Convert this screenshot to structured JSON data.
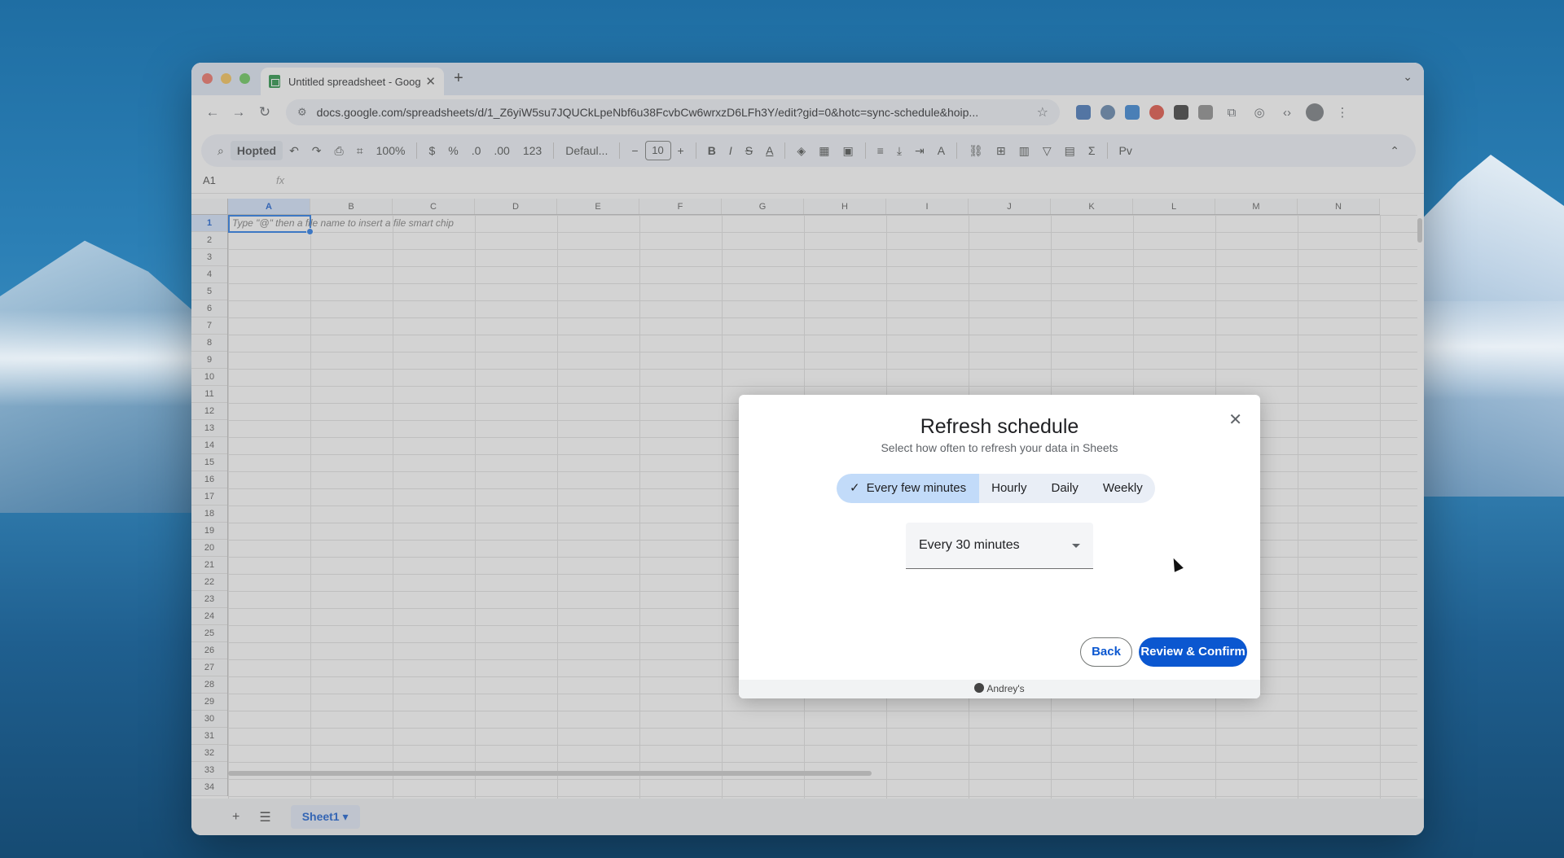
{
  "browser": {
    "tab_title": "Untitled spreadsheet - Googl",
    "url": "docs.google.com/spreadsheets/d/1_Z6yiW5su7JQUCkLpeNbf6u38FcvbCw6wrxzD6LFh3Y/edit?gid=0&hotc=sync-schedule&hoip..."
  },
  "toolbar": {
    "extension_label": "Hopted",
    "zoom": "100%",
    "currency": "$",
    "percent": "%",
    "dec_decrease": ".0",
    "dec_increase": ".00",
    "format_123": "123",
    "font": "Defaul...",
    "font_size": "10",
    "bold": "B",
    "italic": "I",
    "sum": "Σ"
  },
  "formula_bar": {
    "cell_ref": "A1",
    "fx": "fx"
  },
  "grid": {
    "columns": [
      "A",
      "B",
      "C",
      "D",
      "E",
      "F",
      "G",
      "H",
      "I",
      "J",
      "K",
      "L",
      "M",
      "N"
    ],
    "rows": [
      "1",
      "2",
      "3",
      "4",
      "5",
      "6",
      "7",
      "8",
      "9",
      "10",
      "11",
      "12",
      "13",
      "14",
      "15",
      "16",
      "17",
      "18",
      "19",
      "20",
      "21",
      "22",
      "23",
      "24",
      "25",
      "26",
      "27",
      "28",
      "29",
      "30",
      "31",
      "32",
      "33",
      "34"
    ],
    "hint": "Type \"@\" then a file name to insert a file smart chip"
  },
  "sheetbar": {
    "sheet_name": "Sheet1"
  },
  "dialog": {
    "title": "Refresh schedule",
    "subtitle": "Select how often to refresh your data in Sheets",
    "segments": [
      "Every few minutes",
      "Hourly",
      "Daily",
      "Weekly"
    ],
    "selected_segment": "Every few minutes",
    "interval_value": "Every 30 minutes",
    "back_label": "Back",
    "confirm_label": "Review & Confirm",
    "footer": "Andrey's"
  }
}
